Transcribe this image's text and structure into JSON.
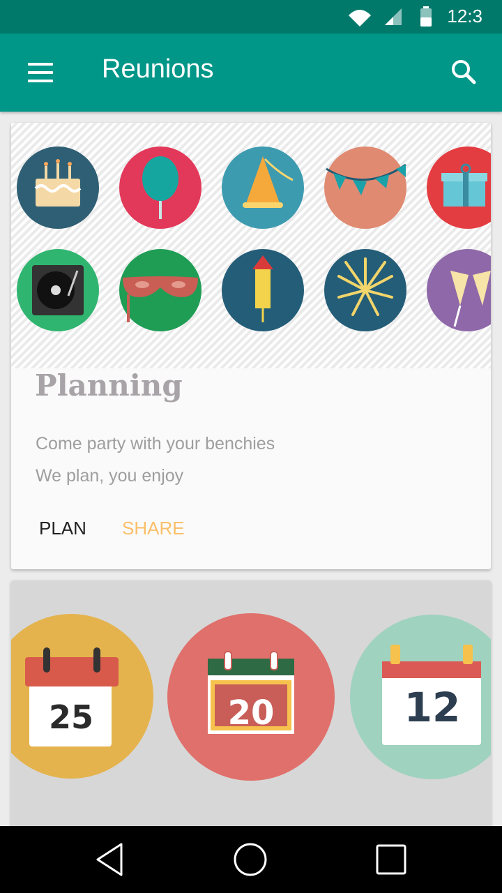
{
  "status_bar": {
    "time": "12:3"
  },
  "app_bar": {
    "title": "Reunions"
  },
  "planning_card": {
    "title": "Planning",
    "lines": [
      "Come party with your benchies",
      "We plan, you enjoy"
    ],
    "actions": {
      "plan_label": "PLAN",
      "share_label": "SHARE"
    },
    "icons": [
      "cake-icon",
      "balloon-icon",
      "party-hat-icon",
      "bunting-icon",
      "gift-icon",
      "turntable-icon",
      "mask-icon",
      "firecracker-icon",
      "fireworks-icon",
      "champagne-icon"
    ]
  },
  "calendar_card": {
    "dates": [
      "25",
      "20",
      "12"
    ]
  },
  "colors": {
    "primary": "#009688",
    "primary_dark": "#00796b",
    "share_accent": "#fbbf6a",
    "plan_text": "#212121"
  }
}
